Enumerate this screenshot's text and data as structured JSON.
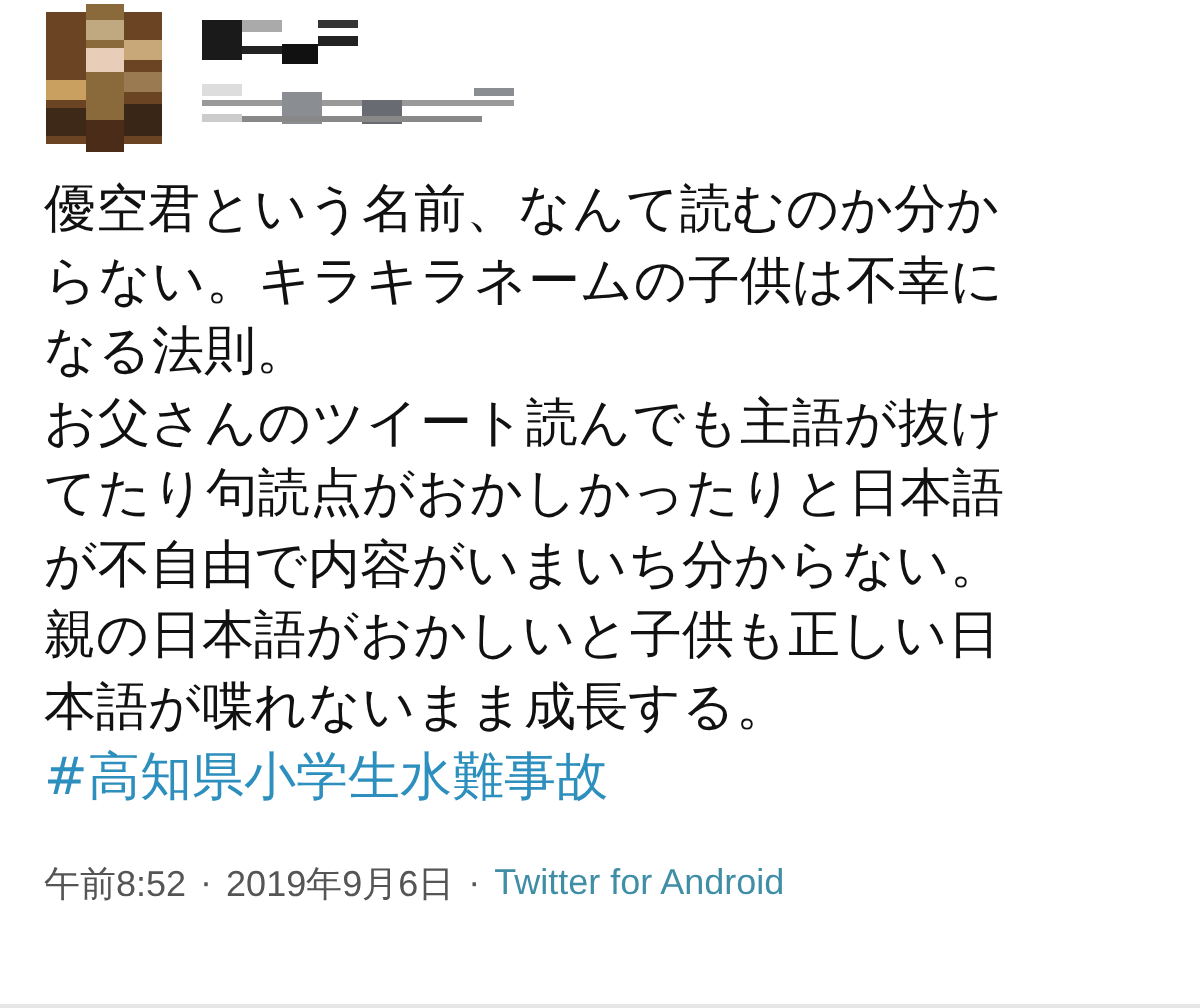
{
  "tweet": {
    "lines": [
      "優空君という名前、なんて読むのか分か",
      "らない。キラキラネームの子供は不幸に",
      "なる法則。",
      "お父さんのツイート読んでも主語が抜け",
      "てたり句読点がおかしかったりと日本語",
      "が不自由で内容がいまいち分からない。",
      "親の日本語がおかしいと子供も正しい日",
      "本語が喋れないまま成長する。"
    ],
    "hashtag": "#高知県小学生水難事故",
    "time": "午前8:52",
    "separator_1": "·",
    "date": "2019年9月6日",
    "separator_2": "·",
    "source": "Twitter for Android"
  }
}
